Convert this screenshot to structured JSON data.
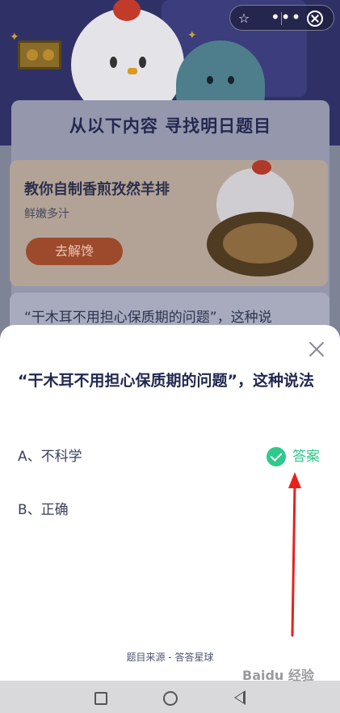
{
  "header": {
    "icons": [
      "star-icon",
      "more-icon",
      "close-circle-icon"
    ]
  },
  "background": {
    "panel_title": "从以下内容  寻找明日题目",
    "promo": {
      "title": "教你自制香煎孜然羊排",
      "subtitle": "鲜嫩多汁",
      "button_label": "去解馋"
    },
    "question_peek": "“干木耳不用担心保质期的问题”，这种说"
  },
  "sheet": {
    "question": "“干木耳不用担心保质期的问题”，这种说法",
    "options": [
      {
        "label": "A、不科学",
        "is_answer": true
      },
      {
        "label": "B、正确",
        "is_answer": false
      }
    ],
    "answer_label": "答案",
    "source": "题目来源 - 答答星球",
    "accent_color": "#2fc98c"
  },
  "watermark": "Baidu 经验"
}
